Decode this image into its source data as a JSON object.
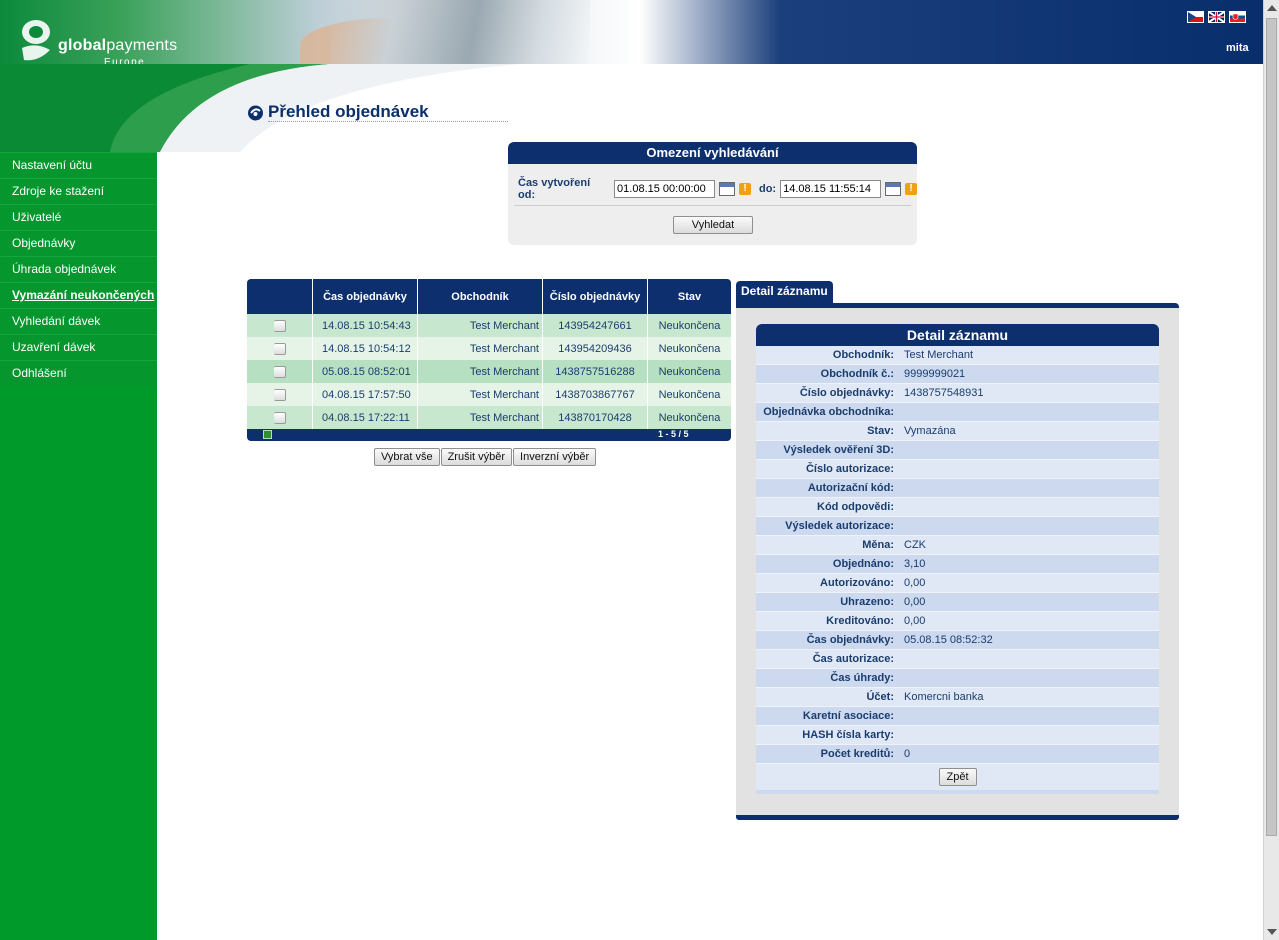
{
  "header": {
    "brand_bold": "global",
    "brand_regular": "payments",
    "brand_sub": "Europe",
    "user": "mita",
    "flags": [
      "cz-flag",
      "uk-flag",
      "sk-flag"
    ]
  },
  "sidebar": {
    "items": [
      {
        "label": "Nastavení účtu"
      },
      {
        "label": "Zdroje ke stažení"
      },
      {
        "label": "Uživatelé"
      },
      {
        "label": "Objednávky"
      },
      {
        "label": "Úhrada objednávek"
      },
      {
        "label": "Vymazání neukončených"
      },
      {
        "label": "Vyhledání dávek"
      },
      {
        "label": "Uzavření dávek"
      },
      {
        "label": "Odhlášení"
      }
    ],
    "active_index": 5
  },
  "page": {
    "title": "Přehled objednávek"
  },
  "search": {
    "title": "Omezení vyhledávání",
    "from_label": "Čas vytvoření od:",
    "from_value": "01.08.15 00:00:00",
    "to_label": "do:",
    "to_value": "14.08.15 11:55:14",
    "button": "Vyhledat"
  },
  "orders": {
    "columns": [
      "",
      "Čas objednávky",
      "Obchodník",
      "Číslo objednávky",
      "Stav"
    ],
    "rows": [
      {
        "time": "14.08.15 10:54:43",
        "merchant": "Test Merchant",
        "number": "143954247661",
        "status": "Neukončena"
      },
      {
        "time": "14.08.15 10:54:12",
        "merchant": "Test Merchant",
        "number": "143954209436",
        "status": "Neukončena"
      },
      {
        "time": "05.08.15 08:52:01",
        "merchant": "Test Merchant",
        "number": "1438757516288",
        "status": "Neukončena"
      },
      {
        "time": "04.08.15 17:57:50",
        "merchant": "Test Merchant",
        "number": "143870386776​7",
        "status": "Neukončena"
      },
      {
        "time": "04.08.15 17:22:11",
        "merchant": "Test Merchant",
        "number": "143870170428",
        "status": "Neukončena"
      }
    ],
    "pagination": "1 - 5 / 5",
    "buttons": [
      "Vybrat vše",
      "Zrušit výběr",
      "Inverzní výběr"
    ]
  },
  "detail": {
    "tab": "Detail záznamu",
    "title": "Detail záznamu",
    "fields": [
      {
        "label": "Obchodník:",
        "value": "Test Merchant"
      },
      {
        "label": "Obchodník č.:",
        "value": "9999999021"
      },
      {
        "label": "Číslo objednávky:",
        "value": "1438757548931"
      },
      {
        "label": "Objednávka obchodníka:",
        "value": ""
      },
      {
        "label": "Stav:",
        "value": "Vymazána"
      },
      {
        "label": "Výsledek ověření 3D:",
        "value": ""
      },
      {
        "label": "Číslo autorizace:",
        "value": ""
      },
      {
        "label": "Autorizační kód:",
        "value": ""
      },
      {
        "label": "Kód odpovědi:",
        "value": ""
      },
      {
        "label": "Výsledek autorizace:",
        "value": ""
      },
      {
        "label": "Měna:",
        "value": "CZK"
      },
      {
        "label": "Objednáno:",
        "value": "3,10"
      },
      {
        "label": "Autorizováno:",
        "value": "0,00"
      },
      {
        "label": "Uhrazeno:",
        "value": "0,00"
      },
      {
        "label": "Kreditováno:",
        "value": "0,00"
      },
      {
        "label": "Čas objednávky:",
        "value": "05.08.15 08:52:32"
      },
      {
        "label": "Čas autorizace:",
        "value": ""
      },
      {
        "label": "Čas úhrady:",
        "value": ""
      },
      {
        "label": "Účet:",
        "value": "Komercni banka"
      },
      {
        "label": "Karetní asociace:",
        "value": ""
      },
      {
        "label": "HASH čísla karty:",
        "value": ""
      },
      {
        "label": "Počet kreditů:",
        "value": "0"
      }
    ],
    "back_button": "Zpět"
  },
  "colors": {
    "navy": "#0e2f6e",
    "green": "#009a2b",
    "row_green": "#c8e7cf",
    "row_blue": "#ccd9ee"
  }
}
